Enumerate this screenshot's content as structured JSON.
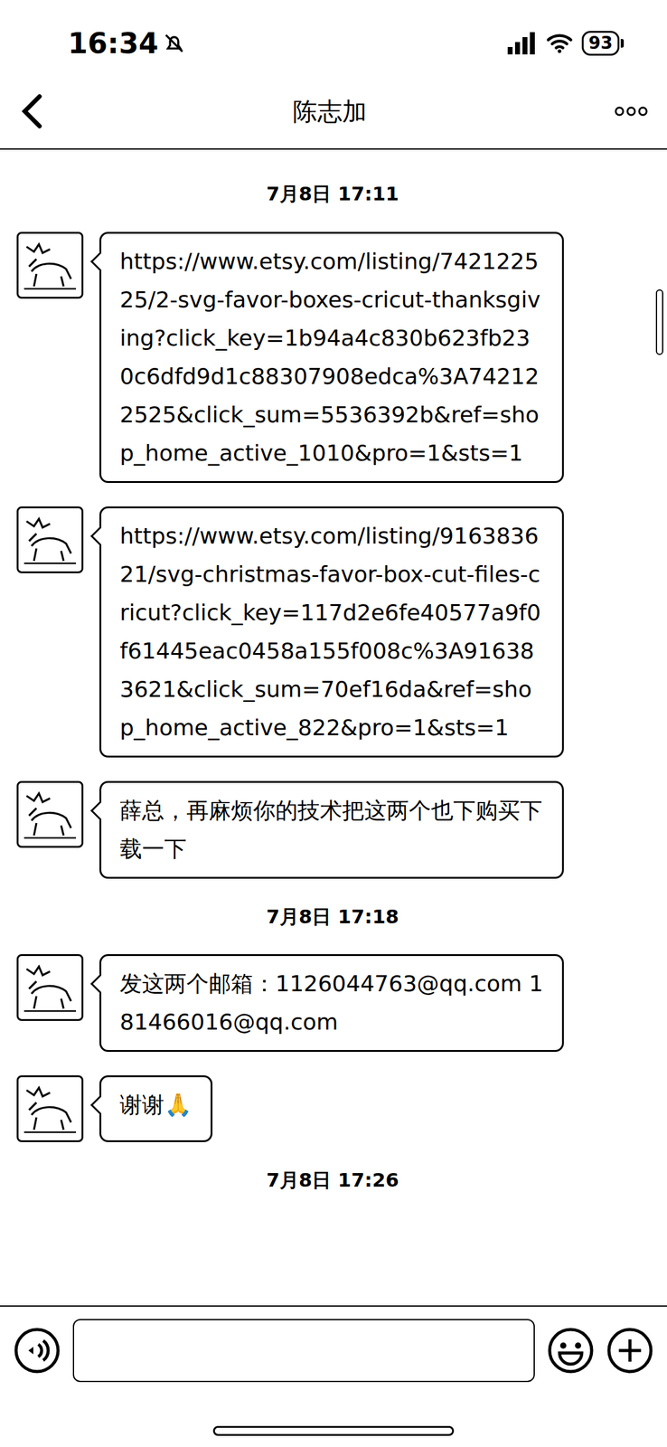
{
  "status_bar": {
    "time": "16:34",
    "battery": "93"
  },
  "header": {
    "title": "陈志加"
  },
  "messages": [
    {
      "kind": "timestamp",
      "text": "7月8日 17:11"
    },
    {
      "kind": "message",
      "text": "https://www.etsy.com/listing/742122525/2-svg-favor-boxes-cricut-thanksgiving?click_key=1b94a4c830b623fb230c6dfd9d1c88307908edca%3A742122525&click_sum=5536392b&ref=shop_home_active_1010&pro=1&sts=1"
    },
    {
      "kind": "message",
      "text": "https://www.etsy.com/listing/916383621/svg-christmas-favor-box-cut-files-cricut?click_key=117d2e6fe40577a9f0f61445eac0458a155f008c%3A916383621&click_sum=70ef16da&ref=shop_home_active_822&pro=1&sts=1"
    },
    {
      "kind": "message",
      "text": "薛总，再麻烦你的技术把这两个也下购买下载一下"
    },
    {
      "kind": "timestamp",
      "text": "7月8日 17:18"
    },
    {
      "kind": "message",
      "text": "发这两个邮箱：1126044763@qq.com   181466016@qq.com"
    },
    {
      "kind": "message",
      "text": "谢谢🙏"
    },
    {
      "kind": "timestamp",
      "text": "7月8日 17:26"
    }
  ]
}
